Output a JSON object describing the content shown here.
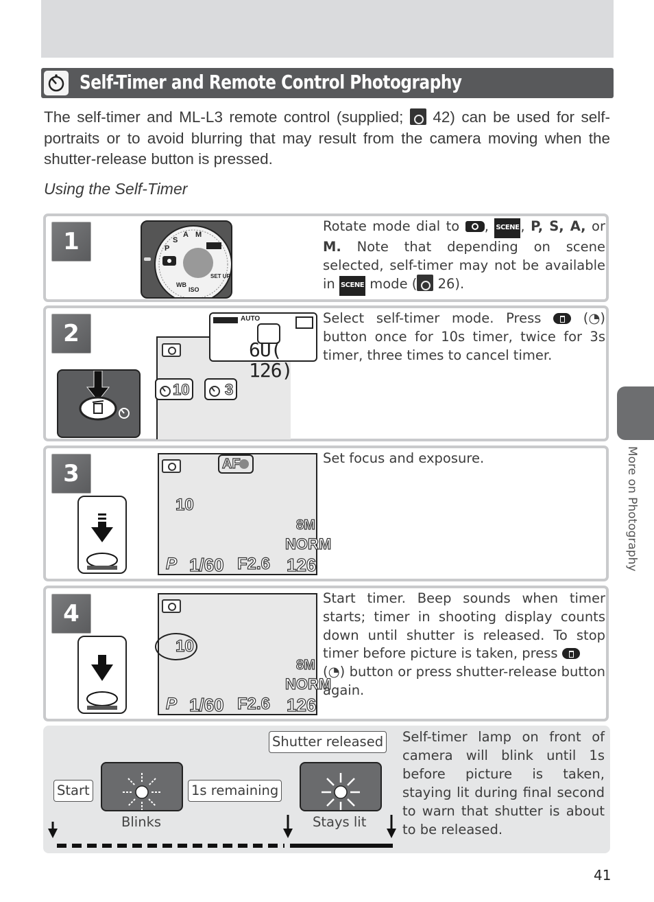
{
  "header": {
    "title": "Self-Timer and Remote Control Photography",
    "title_icon": "self-timer-icon"
  },
  "intro": {
    "part1": "The self-timer and ML-L3 remote control (supplied; ",
    "ref_page": "42",
    "part2": ") can be used for self-portraits or to avoid blurring that may result from the camera moving when the shutter-release button is pressed."
  },
  "subheading": "Using the Self-Timer",
  "steps": [
    {
      "number": "1",
      "text_a": "Rotate mode dial to ",
      "scene_label": "SCENE",
      "text_b": ", ",
      "modes": "P, S, A,",
      "text_c": " or ",
      "mode_m": "M.",
      "text_d": "  Note that depending on scene selected, self-timer may not be available in ",
      "text_e": " mode (",
      "ref_page": "26",
      "text_f": ").",
      "dial_labels": [
        "M",
        "A",
        "S",
        "P",
        "SCENE",
        "SET UP",
        "ISO",
        "WB"
      ]
    },
    {
      "number": "2",
      "text_a": "Select self-timer mode.  Press ",
      "text_b": " (",
      "text_c": ") button once for 10s timer, twice for 3s timer, three times to cancel timer.",
      "lcd_top": {
        "auto": "AUTO",
        "counter": "6U( 126)"
      },
      "timer_10": "10",
      "timer_3": "3"
    },
    {
      "number": "3",
      "text": "Set focus and exposure.",
      "af_label": "AF",
      "timer": "10",
      "size": "8M",
      "quality": "NORM",
      "mode": "P",
      "shutter": "1/60",
      "aperture": "F2.6",
      "exposures": "126"
    },
    {
      "number": "4",
      "text_a": "Start timer.  Beep sounds when timer starts; timer in shooting display counts down until shutter is released.  To stop timer before picture is taken, press ",
      "text_b": " (",
      "text_c": ") button or press shutter-release button again.",
      "timer": "10",
      "size": "8M",
      "quality": "NORM",
      "mode": "P",
      "shutter": "1/60",
      "aperture": "F2.6",
      "exposures": "126"
    }
  ],
  "timeline": {
    "start_label": "Start",
    "remaining_label": "1s remaining",
    "released_label": "Shutter released",
    "blinks_label": "Blinks",
    "stays_label": "Stays lit",
    "description": "Self-timer lamp on front of camera will blink until 1s before picture is taken, staying lit during final second to warn that shutter is about to be released."
  },
  "side_tab": "More on Photography",
  "page_number": "41",
  "colors": {
    "title_bar": "#58595b",
    "top_band": "#dadbdd",
    "step_border": "#c9cacc",
    "timeline_bg": "#e5e6e7",
    "side_tab": "#6d6e70"
  }
}
